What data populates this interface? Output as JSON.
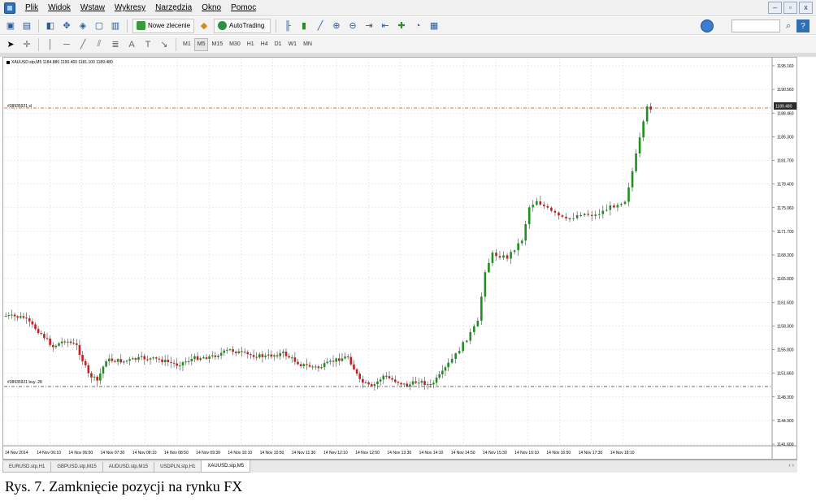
{
  "menu": {
    "items": [
      "Plik",
      "Widok",
      "Wstaw",
      "Wykresy",
      "Narzędzia",
      "Okno",
      "Pomoc"
    ]
  },
  "window_controls": {
    "minimize": "–",
    "restore": "▫",
    "close": "x"
  },
  "toolbar": {
    "new_order_label": "Nowe zlecenie",
    "autotrading_label": "AutoTrading",
    "timeframes": [
      "M1",
      "M5",
      "M15",
      "M30",
      "H1",
      "H4",
      "D1",
      "W1",
      "MN"
    ]
  },
  "chart": {
    "header": "XAUUSD.stp,M5  1184.880 1190.460 1181.100 1189.480",
    "current_price": "1189.480",
    "price_labels": [
      "1195.160",
      "1190.560",
      "1188.460",
      "1185.300",
      "1181.700",
      "1178.400",
      "1175.060",
      "1171.700",
      "1168.300",
      "1165.000",
      "1161.600",
      "1158.300",
      "1155.000",
      "1151.660",
      "1148.300",
      "1144.900",
      "1141.600"
    ],
    "time_labels": [
      "14 Nov 2014",
      "14 Nov 06:10",
      "14 Nov 06:50",
      "14 Nov 07:30",
      "14 Nov 08:10",
      "14 Nov 08:50",
      "14 Nov 09:30",
      "14 Nov 10:10",
      "14 Nov 10:50",
      "14 Nov 11:30",
      "14 Nov 12:10",
      "14 Nov 12:50",
      "14 Nov 13:30",
      "14 Nov 14:10",
      "14 Nov 14:50",
      "14 Nov 15:30",
      "14 Nov 16:10",
      "14 Nov 16:50",
      "14 Nov 17:30",
      "14 Nov 18:10"
    ],
    "sell_line_label": "#38935921 sl",
    "buy_line_label": "#38935921 buy  .28",
    "colors": {
      "bull": "#1f8f1f",
      "bear": "#c81e1e",
      "grid": "#d9d9d9",
      "sell_line": "#ef6a2a",
      "buy_line": "#6b6b6b"
    }
  },
  "tabs": [
    "EURUSD.stp,H1",
    "GBPUSD.stp,M15",
    "AUDUSD.stp,M15",
    "USDPLN.stp,H1",
    "XAUUSD.stp,M5"
  ],
  "active_tab": "XAUUSD.stp,M5",
  "tab_arrows": "‹ ›",
  "caption": "Rys. 7. Zamknięcie pozycji na rynku FX"
}
